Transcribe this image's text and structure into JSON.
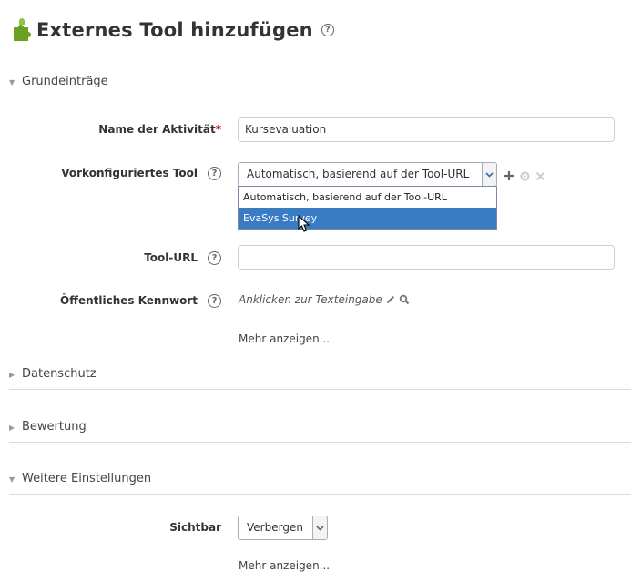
{
  "header": {
    "title": "Externes Tool hinzufügen",
    "help_glyph": "?"
  },
  "sections": {
    "general": "Grundeinträge",
    "privacy": "Datenschutz",
    "grading": "Bewertung",
    "more_settings": "Weitere Einstellungen"
  },
  "form": {
    "activity_name": {
      "label": "Name der Aktivität",
      "required_marker": "*",
      "value": "Kursevaluation"
    },
    "preconfigured_tool": {
      "label": "Vorkonfiguriertes Tool",
      "selected": "Automatisch, basierend auf der Tool-URL",
      "options": [
        "Automatisch, basierend auf der Tool-URL",
        "EvaSys Survey"
      ],
      "highlighted_index": 1
    },
    "tool_url": {
      "label": "Tool-URL",
      "value": ""
    },
    "public_key": {
      "label": "Öffentliches Kennwort",
      "value": "Anklicken zur Texteingabe"
    },
    "show_more_1": "Mehr anzeigen...",
    "visible": {
      "label": "Sichtbar",
      "selected": "Verbergen"
    },
    "show_more_2": "Mehr anzeigen..."
  },
  "icons": {
    "title": "puzzle-icon",
    "help": "help-circle-icon",
    "add": "plus-icon",
    "config": "gear-icon",
    "delete": "close-icon",
    "edit": "pencil-icon",
    "search": "magnifier-icon",
    "cursor": "mouse-pointer-icon"
  },
  "colors": {
    "selection": "#3a7cc4",
    "required": "#cc0000",
    "icon_green": "#6aa121"
  }
}
